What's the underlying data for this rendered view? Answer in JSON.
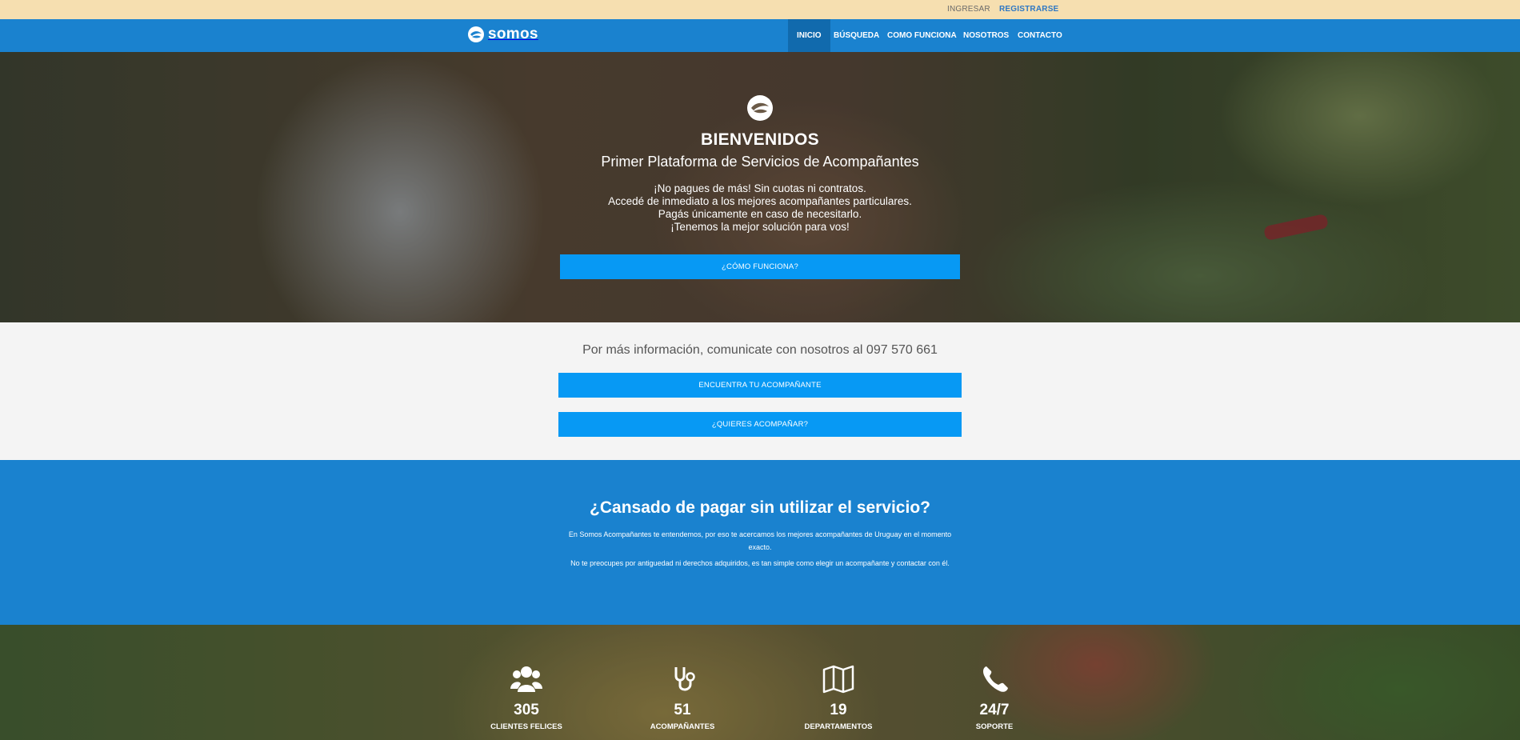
{
  "topbar": {
    "login_label": "INGRESAR",
    "register_label": "REGISTRARSE"
  },
  "navbar": {
    "brand": "somos",
    "items": [
      {
        "label": "INICIO",
        "active": true
      },
      {
        "label": "BÚSQUEDA"
      },
      {
        "label": "COMO FUNCIONA"
      },
      {
        "label": "NOSOTROS"
      },
      {
        "label": "CONTACTO"
      }
    ]
  },
  "hero": {
    "title": "BIENVENIDOS",
    "subtitle": "Primer Plataforma de Servicios de Acompañantes",
    "lines": [
      "¡No pagues de más! Sin cuotas ni contratos.",
      "Accedé de inmediato a los mejores acompañantes particulares.",
      "Pagás únicamente en caso de necesitarlo.",
      "¡Tenemos la mejor solución para vos!"
    ],
    "button_label": "¿CÓMO FUNCIONA?"
  },
  "info": {
    "text": "Por más información, comunicate con nosotros al 097 570 661",
    "find_button": "ENCUENTRA TU ACOMPAÑANTE",
    "join_button": "¿QUIERES ACOMPAÑAR?"
  },
  "promo": {
    "title": "¿Cansado de pagar sin utilizar el servicio?",
    "paragraph1": "En Somos Acompañantes te entendemos, por eso te acercamos los mejores acompañantes de Uruguay en el momento exacto.",
    "paragraph2": "No te preocupes por antiguedad ni derechos adquiridos, es tan simple como elegir un acompañante y contactar con él."
  },
  "stats": [
    {
      "icon": "users-icon",
      "value": "305",
      "label": "CLIENTES FELICES"
    },
    {
      "icon": "stethoscope-icon",
      "value": "51",
      "label": "ACOMPAÑANTES"
    },
    {
      "icon": "map-icon",
      "value": "19",
      "label": "DEPARTAMENTOS"
    },
    {
      "icon": "phone-icon",
      "value": "24/7",
      "label": "SOPORTE"
    }
  ],
  "colors": {
    "primary": "#1a82cf",
    "button": "#0799f4",
    "topbar": "#f6dfb0",
    "active_nav": "#116aad"
  }
}
